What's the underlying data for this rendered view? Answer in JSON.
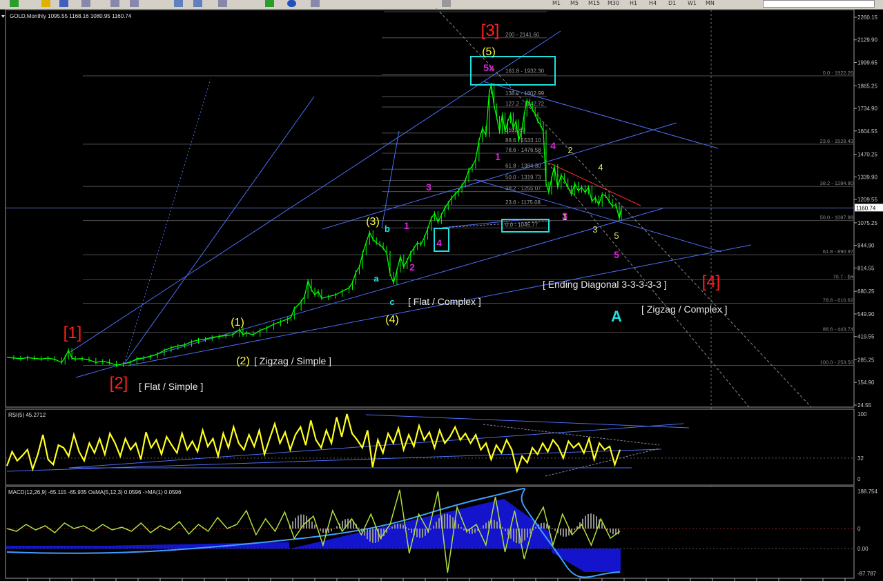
{
  "toolbar": {
    "timeframes": [
      "M1",
      "M5",
      "M15",
      "M30",
      "H1",
      "H4",
      "D1",
      "W1",
      "MN"
    ]
  },
  "chart_data": [
    {
      "type": "line",
      "panel": "price",
      "header": "GOLD,Monthly  1095.55 1168.16 1080.95 1160.74",
      "current_price": "1160.74",
      "y_ticks": [
        "2260.15",
        "2129.90",
        "1999.65",
        "1865.25",
        "1734.90",
        "1604.55",
        "1470.25",
        "1339.90",
        "1209.55",
        "1075.25",
        "944.90",
        "814.55",
        "680.25",
        "549.90",
        "419.55",
        "285.25",
        "154.90",
        "24.55"
      ],
      "y_tick_values": [
        2260.15,
        2129.9,
        1999.65,
        1865.25,
        1734.9,
        1604.55,
        1470.25,
        1339.9,
        1209.55,
        1075.25,
        944.9,
        814.55,
        680.25,
        549.9,
        419.55,
        285.25,
        154.9,
        24.55
      ],
      "ylim": [
        24.55,
        2260.15
      ],
      "fib_left": [
        {
          "value": 2141.6,
          "label": "200 - 2141.60"
        },
        {
          "value": 1932.3,
          "label": "161.8 - 1932.30"
        },
        {
          "value": 1802.99,
          "label": "138.2 - 1802.99"
        },
        {
          "value": 1742.72,
          "label": "127.2 - 1742.72"
        },
        {
          "value": 1592.69,
          "label": "1592.69"
        },
        {
          "value": 1533.1,
          "label": "88.6 - 1533.10"
        },
        {
          "value": 1476.58,
          "label": "78.6 - 1476.58"
        },
        {
          "value": 1384.3,
          "label": "61.8 - 1384.30"
        },
        {
          "value": 1319.73,
          "label": "50.0 - 1319.73"
        },
        {
          "value": 1255.07,
          "label": "38.2 - 1255.07"
        },
        {
          "value": 1175.08,
          "label": "23.6 - 1175.08"
        },
        {
          "value": 1045.77,
          "label": "0.0 - 1045.77"
        }
      ],
      "fib_right": [
        {
          "value": 1922.26,
          "label": "0.0 - 1922.26"
        },
        {
          "value": 1528.43,
          "label": "23.6 - 1528.43"
        },
        {
          "value": 1284.8,
          "label": "38.2 - 1284.80"
        },
        {
          "value": 1087.88,
          "label": "50.0 - 1087.88"
        },
        {
          "value": 890.97,
          "label": "61.8 - 890.97"
        },
        {
          "value": 747.0,
          "label": "70.7 - $#"
        },
        {
          "value": 610.62,
          "label": "78.6 - 610.62"
        },
        {
          "value": 443.74,
          "label": "88.6 - 443.74"
        },
        {
          "value": 253.5,
          "label": "100.0 - 253.50"
        }
      ],
      "price_path": [
        [
          0,
          300
        ],
        [
          10,
          296
        ],
        [
          20,
          292
        ],
        [
          30,
          298
        ],
        [
          40,
          294
        ],
        [
          50,
          290
        ],
        [
          60,
          295
        ],
        [
          70,
          288
        ],
        [
          80,
          270
        ],
        [
          85,
          300
        ],
        [
          90,
          340
        ],
        [
          95,
          295
        ],
        [
          100,
          290
        ],
        [
          110,
          292
        ],
        [
          120,
          285
        ],
        [
          130,
          270
        ],
        [
          140,
          278
        ],
        [
          150,
          268
        ],
        [
          160,
          255
        ],
        [
          170,
          262
        ],
        [
          180,
          270
        ],
        [
          190,
          292
        ],
        [
          200,
          296
        ],
        [
          210,
          305
        ],
        [
          220,
          318
        ],
        [
          230,
          340
        ],
        [
          240,
          355
        ],
        [
          250,
          365
        ],
        [
          260,
          372
        ],
        [
          270,
          390
        ],
        [
          280,
          400
        ],
        [
          290,
          405
        ],
        [
          300,
          415
        ],
        [
          310,
          420
        ],
        [
          320,
          425
        ],
        [
          330,
          430
        ],
        [
          340,
          460
        ],
        [
          345,
          430
        ],
        [
          350,
          440
        ],
        [
          360,
          430
        ],
        [
          370,
          455
        ],
        [
          380,
          470
        ],
        [
          390,
          490
        ],
        [
          400,
          505
        ],
        [
          410,
          520
        ],
        [
          415,
          530
        ],
        [
          420,
          580
        ],
        [
          430,
          620
        ],
        [
          435,
          650
        ],
        [
          440,
          740
        ],
        [
          445,
          690
        ],
        [
          450,
          660
        ],
        [
          455,
          680
        ],
        [
          460,
          640
        ],
        [
          470,
          650
        ],
        [
          480,
          660
        ],
        [
          490,
          680
        ],
        [
          500,
          700
        ],
        [
          505,
          730
        ],
        [
          510,
          790
        ],
        [
          515,
          820
        ],
        [
          520,
          900
        ],
        [
          525,
          960
        ],
        [
          530,
          1020
        ],
        [
          535,
          980
        ],
        [
          540,
          960
        ],
        [
          545,
          950
        ],
        [
          550,
          930
        ],
        [
          555,
          900
        ],
        [
          560,
          780
        ],
        [
          565,
          730
        ],
        [
          570,
          800
        ],
        [
          575,
          880
        ],
        [
          580,
          820
        ],
        [
          585,
          860
        ],
        [
          590,
          900
        ],
        [
          595,
          930
        ],
        [
          600,
          960
        ],
        [
          605,
          950
        ],
        [
          610,
          990
        ],
        [
          615,
          1040
        ],
        [
          620,
          1100
        ],
        [
          625,
          1130
        ],
        [
          630,
          1080
        ],
        [
          635,
          1120
        ],
        [
          640,
          1160
        ],
        [
          645,
          1190
        ],
        [
          650,
          1220
        ],
        [
          655,
          1240
        ],
        [
          660,
          1260
        ],
        [
          665,
          1290
        ],
        [
          670,
          1320
        ],
        [
          675,
          1380
        ],
        [
          680,
          1400
        ],
        [
          685,
          1440
        ],
        [
          690,
          1550
        ],
        [
          695,
          1620
        ],
        [
          700,
          1580
        ],
        [
          705,
          1830
        ],
        [
          708,
          1870
        ],
        [
          712,
          1750
        ],
        [
          716,
          1680
        ],
        [
          720,
          1600
        ],
        [
          724,
          1700
        ],
        [
          728,
          1600
        ],
        [
          732,
          1660
        ],
        [
          736,
          1700
        ],
        [
          740,
          1620
        ],
        [
          744,
          1660
        ],
        [
          748,
          1550
        ],
        [
          752,
          1600
        ],
        [
          756,
          1700
        ],
        [
          760,
          1780
        ],
        [
          764,
          1760
        ],
        [
          768,
          1730
        ],
        [
          772,
          1700
        ],
        [
          776,
          1660
        ],
        [
          780,
          1640
        ],
        [
          784,
          1600
        ],
        [
          788,
          1300
        ],
        [
          792,
          1250
        ],
        [
          796,
          1330
        ],
        [
          800,
          1400
        ],
        [
          805,
          1280
        ],
        [
          810,
          1350
        ],
        [
          815,
          1320
        ],
        [
          820,
          1280
        ],
        [
          825,
          1240
        ],
        [
          830,
          1300
        ],
        [
          835,
          1260
        ],
        [
          840,
          1280
        ],
        [
          845,
          1250
        ],
        [
          850,
          1280
        ],
        [
          855,
          1200
        ],
        [
          860,
          1220
        ],
        [
          865,
          1180
        ],
        [
          870,
          1240
        ],
        [
          875,
          1230
        ],
        [
          880,
          1200
        ],
        [
          885,
          1170
        ],
        [
          890,
          1180
        ],
        [
          895,
          1100
        ],
        [
          898,
          1160
        ]
      ],
      "annotations": {
        "red": [
          {
            "text": "[1]"
          },
          {
            "text": "[2]"
          },
          {
            "text": "[3]"
          },
          {
            "text": "[4]"
          }
        ],
        "yellow": [
          {
            "text": "(1)"
          },
          {
            "text": "(2)"
          },
          {
            "text": "(3)"
          },
          {
            "text": "(4)"
          },
          {
            "text": "(5)"
          }
        ],
        "magenta": [
          {
            "text": "1"
          },
          {
            "text": "2"
          },
          {
            "text": "3"
          },
          {
            "text": "4"
          },
          {
            "text": "5x"
          },
          {
            "text": "1"
          },
          {
            "text": "3"
          },
          {
            "text": "4"
          },
          {
            "text": "5"
          }
        ],
        "small_yellow": [
          {
            "text": "1"
          },
          {
            "text": "2"
          },
          {
            "text": "3"
          },
          {
            "text": "4"
          },
          {
            "text": "5"
          }
        ],
        "cyan": [
          {
            "text": "a"
          },
          {
            "text": "b"
          },
          {
            "text": "c"
          },
          {
            "text": "A"
          }
        ],
        "white": [
          {
            "text": "[ Zigzag / Simple ]"
          },
          {
            "text": "[ Flat / Simple ]"
          },
          {
            "text": "[ Flat / Complex ]"
          },
          {
            "text": "[ Ending Diagonal 3-3-3-3-3 ]"
          },
          {
            "text": "[ Zigzag / Complex ]"
          }
        ]
      },
      "colors": {
        "price": "#00ff00",
        "trendlines": "#4c6ef5",
        "fib": "#808080",
        "red_label": "#ff2020",
        "yellow_label": "#ffff40",
        "magenta_label": "#e020e0",
        "cyan_label": "#20e0e0"
      }
    },
    {
      "type": "line",
      "panel": "rsi",
      "header": "RSI(5) 45.2712",
      "y_ticks": [
        "100",
        "32",
        "0"
      ],
      "y_tick_values": [
        100,
        32,
        0
      ],
      "ylim": [
        0,
        100
      ],
      "series": [
        {
          "values": [
            20,
            42,
            28,
            36,
            45,
            15,
            38,
            68,
            30,
            22,
            52,
            48,
            35,
            68,
            42,
            28,
            55,
            40,
            62,
            38,
            70,
            55,
            35,
            62,
            45,
            55,
            30,
            72,
            48,
            60,
            38,
            65,
            52,
            40,
            70,
            45,
            58,
            42,
            75,
            50,
            62,
            35,
            70,
            48,
            80,
            55,
            45,
            68,
            50,
            75,
            38,
            62,
            85,
            55,
            72,
            45,
            68,
            80,
            52,
            90,
            60,
            48,
            75,
            55,
            95,
            65,
            100,
            70,
            60,
            48,
            75,
            18,
            60,
            40,
            70,
            55,
            78,
            45,
            68,
            50,
            82,
            60,
            72,
            48,
            75,
            55,
            65,
            80,
            60,
            70,
            55,
            68,
            45,
            55,
            30,
            52,
            40,
            60,
            45,
            12,
            35,
            25,
            48,
            38,
            55,
            42,
            60,
            50,
            32,
            58,
            48,
            55,
            40,
            62,
            30,
            55,
            45,
            50,
            22,
            45
          ]
        }
      ]
    },
    {
      "type": "bar",
      "panel": "macd",
      "header": "MACD(12,26,9) -65.115 -65.935  OsMA(5,12,3) 0.0596  ->MA(1) 0.0596",
      "y_ticks": [
        "188.754",
        "0",
        "0.00",
        "-87.787"
      ],
      "y_tick_values": [
        188.754,
        0,
        0,
        -87.787
      ],
      "ylim": [
        -87.787,
        188.754
      ]
    }
  ]
}
